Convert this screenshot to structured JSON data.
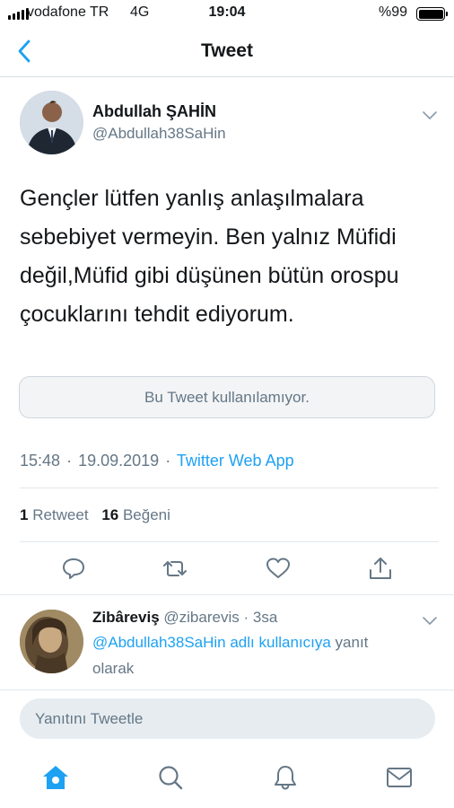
{
  "status_bar": {
    "carrier": "vodafone TR",
    "network": "4G",
    "time": "19:04",
    "battery": "%99"
  },
  "nav": {
    "title": "Tweet",
    "back_icon": "chevron-left-icon"
  },
  "tweet": {
    "author_name": "Abdullah ŞAHİN",
    "author_handle": "@Abdullah38SaHin",
    "text": "Gençler lütfen yanlış anlaşılmalara sebebiyet vermeyin. Ben yalnız Müfidi değil,Müfid gibi düşünen bütün orospu çocuklarını tehdit ediyorum.",
    "quoted_unavailable": "Bu Tweet kullanılamıyor.",
    "time": "15:48",
    "date": "19.09.2019",
    "separator": "·",
    "source": "Twitter Web App",
    "retweet_count": "1",
    "retweet_label": "Retweet",
    "like_count": "16",
    "like_label": "Beğeni"
  },
  "actions": [
    {
      "icon": "reply-icon"
    },
    {
      "icon": "retweet-icon"
    },
    {
      "icon": "heart-icon"
    },
    {
      "icon": "share-icon"
    }
  ],
  "reply": {
    "name": "Zibâreviş",
    "handle": "@zibarevis",
    "dot": "·",
    "age": "3sa",
    "mention": "@Abdullah38SaHin adlı kullanıcıya",
    "line1_suffix": " yanıt",
    "line2": "olarak"
  },
  "compose": {
    "placeholder": "Yanıtını Tweetle"
  },
  "tabs": [
    {
      "icon": "home-icon",
      "active": true
    },
    {
      "icon": "search-icon",
      "active": false
    },
    {
      "icon": "notifications-icon",
      "active": false
    },
    {
      "icon": "messages-icon",
      "active": false
    }
  ],
  "colors": {
    "accent": "#1da1f2",
    "secondary_text": "#657786",
    "primary_text": "#14171a",
    "divider": "#e1e8ed",
    "compose_bg": "#e6ecf0"
  }
}
